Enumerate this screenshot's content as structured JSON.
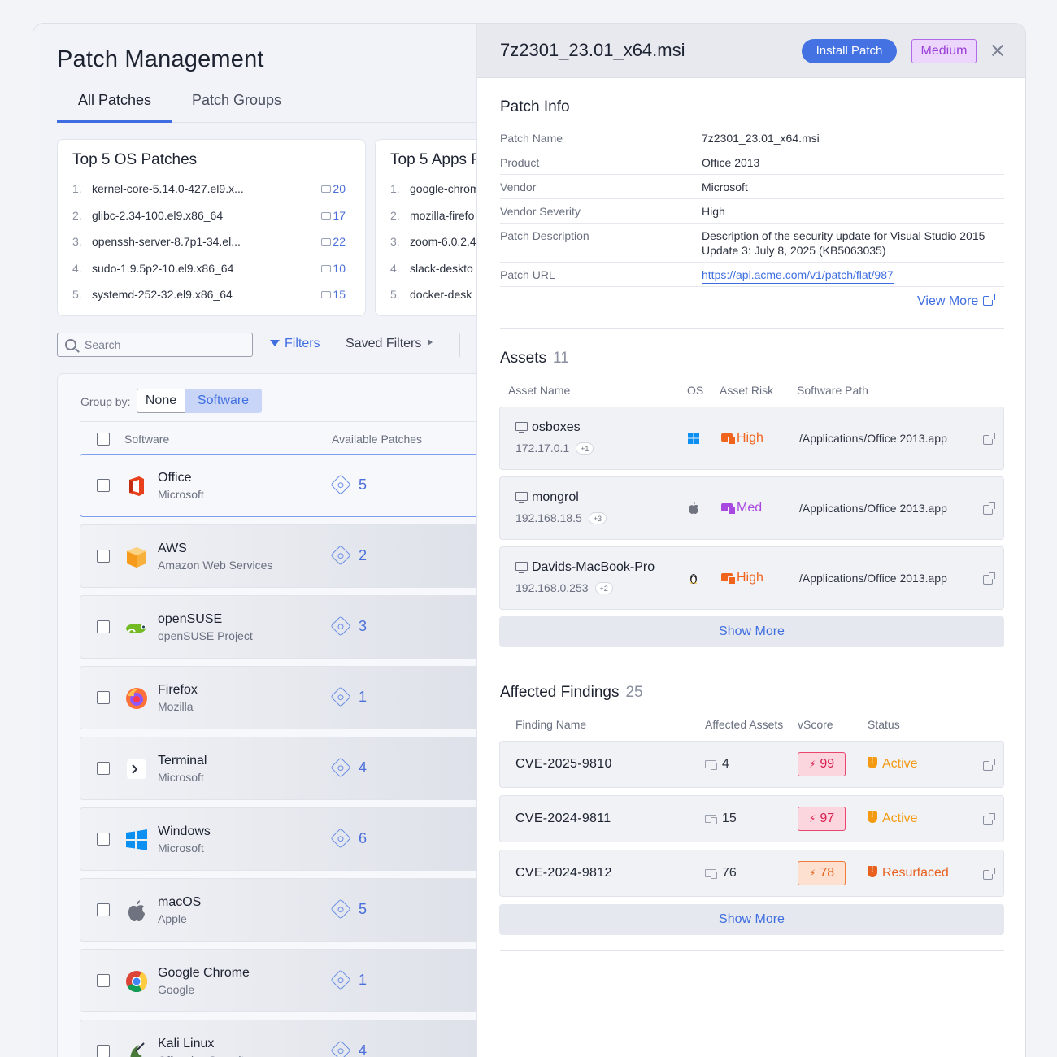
{
  "page": {
    "title": "Patch Management"
  },
  "tabs": [
    {
      "label": "All Patches"
    },
    {
      "label": "Patch Groups"
    }
  ],
  "top_os": {
    "title": "Top 5 OS Patches",
    "items": [
      {
        "rank": "1.",
        "name": "kernel-core-5.14.0-427.el9.x...",
        "count": "20"
      },
      {
        "rank": "2.",
        "name": "glibc-2.34-100.el9.x86_64",
        "count": "17"
      },
      {
        "rank": "3.",
        "name": "openssh-server-8.7p1-34.el...",
        "count": "22"
      },
      {
        "rank": "4.",
        "name": "sudo-1.9.5p2-10.el9.x86_64",
        "count": "10"
      },
      {
        "rank": "5.",
        "name": "systemd-252-32.el9.x86_64",
        "count": "15"
      }
    ]
  },
  "top_apps": {
    "title": "Top 5 Apps F",
    "items": [
      {
        "rank": "1.",
        "name": "google-chrom"
      },
      {
        "rank": "2.",
        "name": "mozilla-firefo"
      },
      {
        "rank": "3.",
        "name": "zoom-6.0.2.4"
      },
      {
        "rank": "4.",
        "name": "slack-deskto"
      },
      {
        "rank": "5.",
        "name": "docker-desk"
      }
    ]
  },
  "toolbar": {
    "search_placeholder": "Search",
    "filters_label": "Filters",
    "saved_filters_label": "Saved Filters"
  },
  "groupby": {
    "label": "Group by:",
    "options": [
      "None",
      "Software"
    ],
    "selected": "Software"
  },
  "list_headers": {
    "software": "Software",
    "available": "Available Patches"
  },
  "software": [
    {
      "name": "Office",
      "vendor": "Microsoft",
      "patches": "5",
      "logo": "office-icon"
    },
    {
      "name": "AWS",
      "vendor": "Amazon Web Services",
      "patches": "2",
      "logo": "aws-icon"
    },
    {
      "name": "openSUSE",
      "vendor": "openSUSE Project",
      "patches": "3",
      "logo": "opensuse-icon"
    },
    {
      "name": "Firefox",
      "vendor": "Mozilla",
      "patches": "1",
      "logo": "firefox-icon"
    },
    {
      "name": "Terminal",
      "vendor": "Microsoft",
      "patches": "4",
      "logo": "terminal-icon"
    },
    {
      "name": "Windows",
      "vendor": "Microsoft",
      "patches": "6",
      "logo": "windows-icon"
    },
    {
      "name": "macOS",
      "vendor": "Apple",
      "patches": "5",
      "logo": "apple-icon"
    },
    {
      "name": "Google Chrome",
      "vendor": "Google",
      "patches": "1",
      "logo": "chrome-icon"
    },
    {
      "name": "Kali Linux",
      "vendor": "Offensive Security",
      "patches": "4",
      "logo": "kali-icon"
    }
  ],
  "detail": {
    "title": "7z2301_23.01_x64.msi",
    "install_label": "Install Patch",
    "severity": "Medium",
    "patch_info_title": "Patch Info",
    "info": [
      {
        "label": "Patch Name",
        "value": "7z2301_23.01_x64.msi"
      },
      {
        "label": "Product",
        "value": "Office 2013"
      },
      {
        "label": "Vendor",
        "value": "Microsoft"
      },
      {
        "label": "Vendor Severity",
        "value": "High"
      },
      {
        "label": "Patch Description",
        "value": "Description of the security update for Visual Studio 2015 Update 3: July 8, 2025 (KB5063035)"
      },
      {
        "label": "Patch URL",
        "value": "https://api.acme.com/v1/patch/flat/987"
      }
    ],
    "view_more_label": "View More",
    "assets_title": "Assets",
    "assets_count": "11",
    "asset_headers": {
      "name": "Asset Name",
      "os": "OS",
      "risk": "Asset Risk",
      "path": "Software Path"
    },
    "assets": [
      {
        "name": "osboxes",
        "ip": "172.17.0.1",
        "more": "+1",
        "os": "windows-icon",
        "risk": "High",
        "risk_color": "#f0641e",
        "path": "/Applications/Office 2013.app"
      },
      {
        "name": "mongrol",
        "ip": "192.168.18.5",
        "more": "+3",
        "os": "apple-icon",
        "risk": "Med",
        "risk_color": "#a848e0",
        "path": "/Applications/Office 2013.app"
      },
      {
        "name": "Davids-MacBook-Pro",
        "ip": "192.168.0.253",
        "more": "+2",
        "os": "linux-icon",
        "risk": "High",
        "risk_color": "#f0641e",
        "path": "/Applications/Office 2013.app"
      }
    ],
    "show_more_label": "Show More",
    "findings_title": "Affected Findings",
    "findings_count": "25",
    "finding_headers": {
      "name": "Finding Name",
      "assets": "Affected Assets",
      "vscore": "vScore",
      "status": "Status"
    },
    "findings": [
      {
        "name": "CVE-2025-9810",
        "assets": "4",
        "vscore": "99",
        "status": "Active",
        "score_bg": "#fcd6df",
        "score_border": "#e8466e",
        "score_color": "#d8204e",
        "status_color": "#f39a12"
      },
      {
        "name": "CVE-2024-9811",
        "assets": "15",
        "vscore": "97",
        "status": "Active",
        "score_bg": "#fcd6df",
        "score_border": "#e8466e",
        "score_color": "#d8204e",
        "status_color": "#f39a12"
      },
      {
        "name": "CVE-2024-9812",
        "assets": "76",
        "vscore": "78",
        "status": "Resurfaced",
        "score_bg": "#fde0cf",
        "score_border": "#f07a3a",
        "score_color": "#e2621a",
        "status_color": "#e8601e"
      }
    ]
  }
}
